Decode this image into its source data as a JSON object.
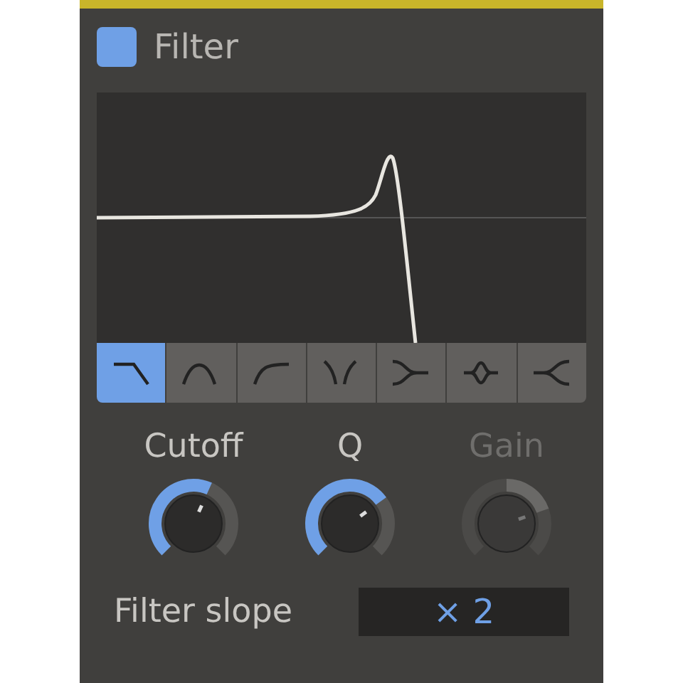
{
  "header": {
    "checked": true,
    "title": "Filter"
  },
  "filter_types": [
    {
      "kind": "lowpass",
      "selected": true
    },
    {
      "kind": "bandpass",
      "selected": false
    },
    {
      "kind": "highpass",
      "selected": false
    },
    {
      "kind": "notch",
      "selected": false
    },
    {
      "kind": "converge",
      "selected": false
    },
    {
      "kind": "peak",
      "selected": false
    },
    {
      "kind": "diverge",
      "selected": false
    }
  ],
  "knobs": [
    {
      "label": "Cutoff",
      "kind": "unipolar",
      "disabled": false
    },
    {
      "label": "Q",
      "kind": "unipolar",
      "disabled": false
    },
    {
      "label": "Gain",
      "kind": "bipolar",
      "disabled": true
    }
  ],
  "slope": {
    "label": "Filter slope",
    "value": "× 2"
  }
}
